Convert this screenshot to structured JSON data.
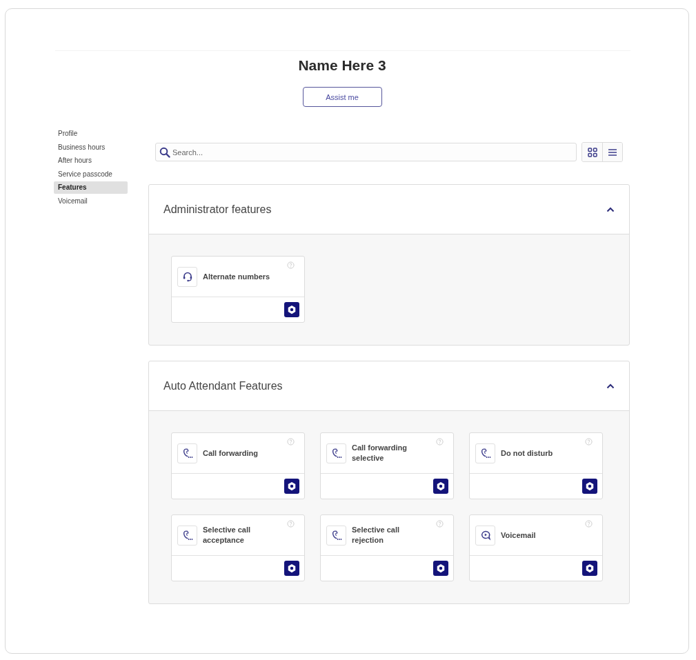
{
  "header": {
    "title": "Name Here 3",
    "assist_button": "Assist me"
  },
  "sidebar": {
    "items": [
      {
        "label": "Profile",
        "selected": false
      },
      {
        "label": "Business hours",
        "selected": false
      },
      {
        "label": "After hours",
        "selected": false
      },
      {
        "label": "Service passcode",
        "selected": false
      },
      {
        "label": "Features",
        "selected": true
      },
      {
        "label": "Voicemail",
        "selected": false
      }
    ]
  },
  "search": {
    "placeholder": "Search..."
  },
  "sections": [
    {
      "title": "Administrator features",
      "expanded": true,
      "features": [
        {
          "label": "Alternate numbers",
          "kind": "headset"
        }
      ]
    },
    {
      "title": "Auto Attendant Features",
      "expanded": true,
      "features": [
        {
          "label": "Call forwarding",
          "kind": "phone"
        },
        {
          "label": "Call forwarding selective",
          "kind": "phone"
        },
        {
          "label": "Do not disturb",
          "kind": "phone"
        },
        {
          "label": "Selective call acceptance",
          "kind": "phone"
        },
        {
          "label": "Selective call rejection",
          "kind": "phone"
        },
        {
          "label": "Voicemail",
          "kind": "voicemail"
        }
      ]
    }
  ]
}
